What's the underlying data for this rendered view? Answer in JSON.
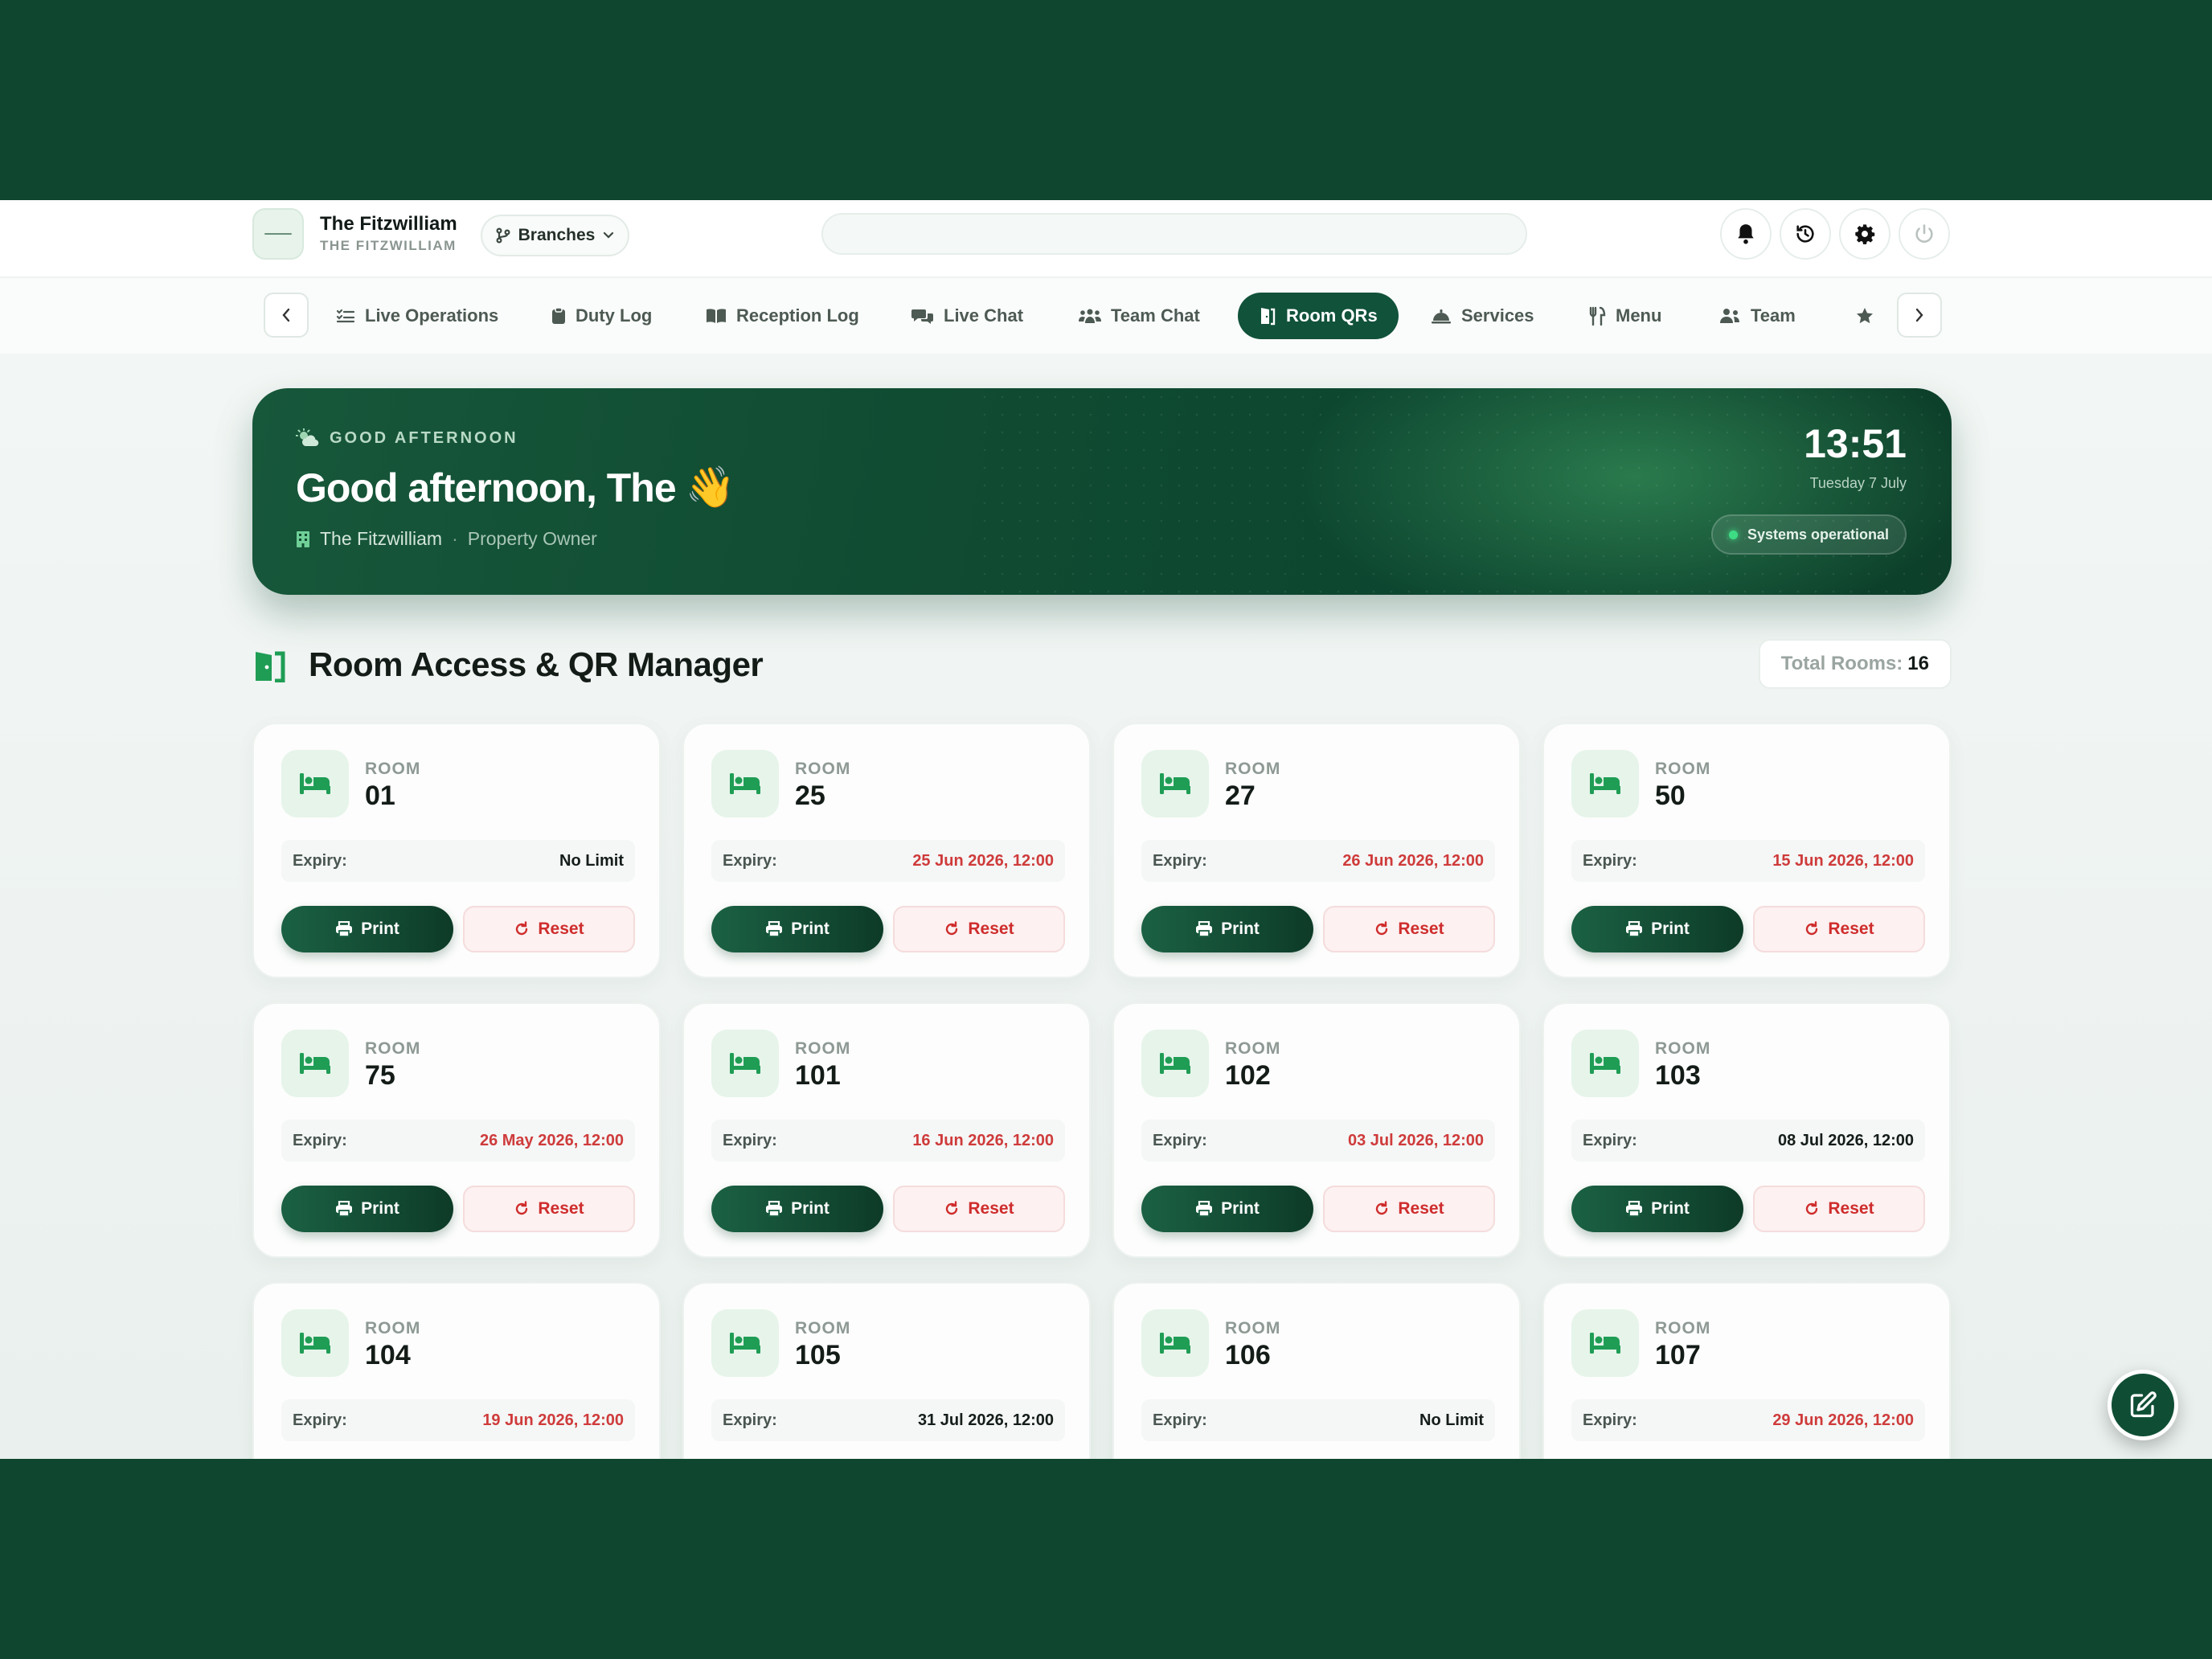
{
  "header": {
    "brand_name": "The Fitzwilliam",
    "brand_sub": "THE FITZWILLIAM",
    "branches_label": "Branches",
    "search_placeholder": ""
  },
  "nav": {
    "tabs": [
      {
        "label": "Live Operations",
        "icon": "checklist-icon"
      },
      {
        "label": "Duty Log",
        "icon": "clipboard-icon"
      },
      {
        "label": "Reception Log",
        "icon": "book-icon"
      },
      {
        "label": "Live Chat",
        "icon": "chat-bubbles-icon"
      },
      {
        "label": "Team Chat",
        "icon": "people-icon"
      },
      {
        "label": "Room QRs",
        "icon": "door-icon",
        "active": true
      },
      {
        "label": "Services",
        "icon": "bell-service-icon"
      },
      {
        "label": "Menu",
        "icon": "cutlery-icon"
      },
      {
        "label": "Team",
        "icon": "users-icon"
      }
    ]
  },
  "hero": {
    "greeting_small": "GOOD AFTERNOON",
    "greeting_big": "Good afternoon, The",
    "emoji": "👋",
    "property": "The Fitzwilliam",
    "separator": "·",
    "role": "Property Owner",
    "time": "13:51",
    "date": "Tuesday 7 July",
    "status": "Systems operational"
  },
  "section": {
    "title": "Room Access & QR Manager",
    "total_label": "Total Rooms:",
    "total_value": "16"
  },
  "card_labels": {
    "room": "ROOM",
    "expiry": "Expiry:",
    "print": "Print",
    "reset": "Reset"
  },
  "rooms": [
    {
      "number": "01",
      "expiry": "No Limit",
      "expired": false
    },
    {
      "number": "25",
      "expiry": "25 Jun 2026, 12:00",
      "expired": true
    },
    {
      "number": "27",
      "expiry": "26 Jun 2026, 12:00",
      "expired": true
    },
    {
      "number": "50",
      "expiry": "15 Jun 2026, 12:00",
      "expired": true
    },
    {
      "number": "75",
      "expiry": "26 May 2026, 12:00",
      "expired": true
    },
    {
      "number": "101",
      "expiry": "16 Jun 2026, 12:00",
      "expired": true
    },
    {
      "number": "102",
      "expiry": "03 Jul 2026, 12:00",
      "expired": true
    },
    {
      "number": "103",
      "expiry": "08 Jul 2026, 12:00",
      "expired": false
    },
    {
      "number": "104",
      "expiry": "19 Jun 2026, 12:00",
      "expired": true
    },
    {
      "number": "105",
      "expiry": "31 Jul 2026, 12:00",
      "expired": false
    },
    {
      "number": "106",
      "expiry": "No Limit",
      "expired": false
    },
    {
      "number": "107",
      "expiry": "29 Jun 2026, 12:00",
      "expired": true
    }
  ],
  "colors": {
    "brand": "#11523a",
    "accent_green": "#1f9d55",
    "expired_red": "#cf3b3b"
  }
}
